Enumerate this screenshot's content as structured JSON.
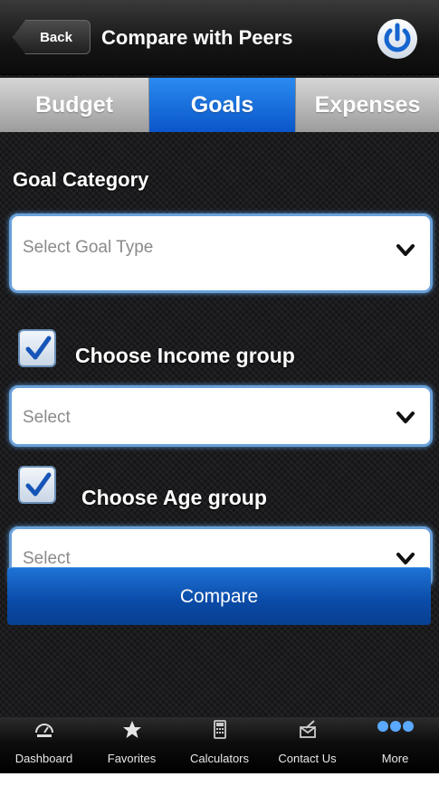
{
  "navbar": {
    "back_label": "Back",
    "title": "Compare with Peers",
    "power_icon": "power-icon"
  },
  "tabs": [
    {
      "label": "Budget",
      "active": false
    },
    {
      "label": "Goals",
      "active": true
    },
    {
      "label": "Expenses",
      "active": false
    }
  ],
  "form": {
    "goal_category_label": "Goal Category",
    "goal_type_placeholder": "Select Goal Type",
    "income": {
      "checked": true,
      "label": "Choose Income group",
      "select_placeholder": "Select"
    },
    "age": {
      "checked": true,
      "label": "Choose Age group",
      "select_placeholder": "Select"
    },
    "compare_label": "Compare"
  },
  "tabbar": [
    {
      "label": "Dashboard",
      "icon": "dashboard-icon"
    },
    {
      "label": "Favorites",
      "icon": "star-icon"
    },
    {
      "label": "Calculators",
      "icon": "calculator-icon"
    },
    {
      "label": "Contact Us",
      "icon": "contact-icon"
    },
    {
      "label": "More",
      "icon": "more-dots-icon"
    }
  ],
  "colors": {
    "accent": "#0a56c9",
    "select_border": "#6aa0d8",
    "tab_inactive": "#b0b0b0"
  }
}
